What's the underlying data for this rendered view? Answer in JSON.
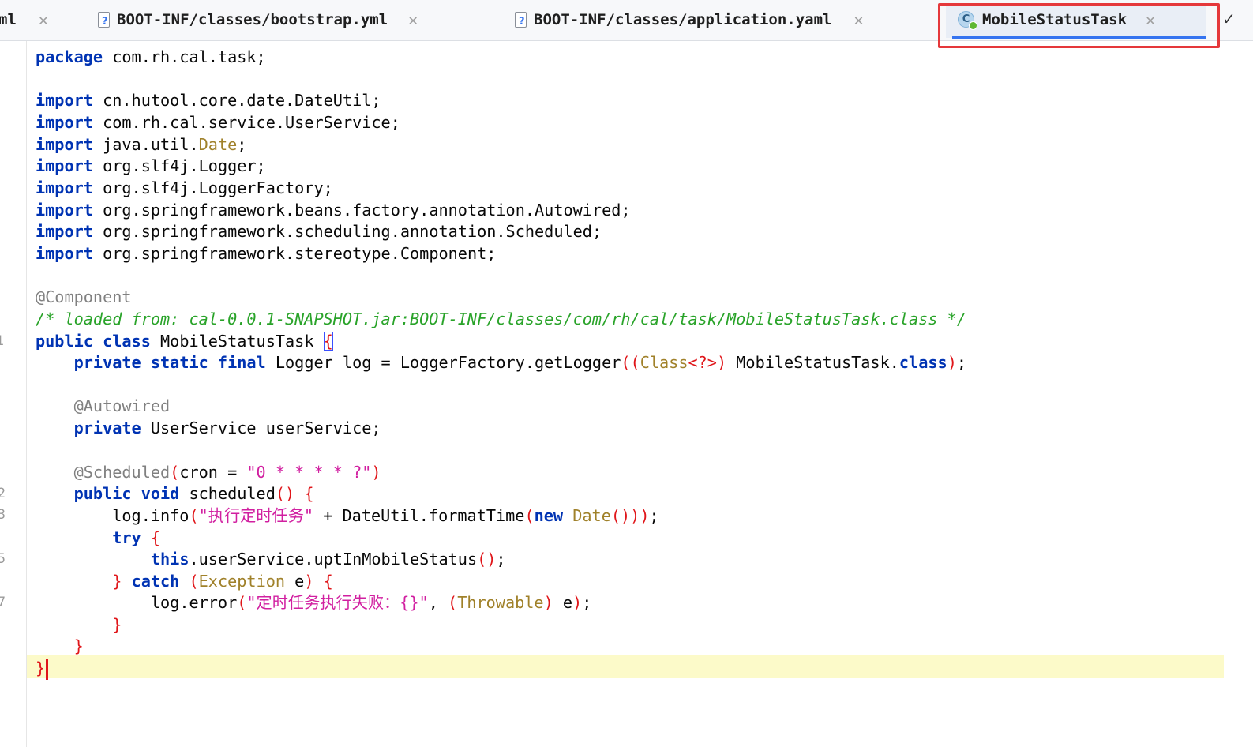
{
  "tabs": [
    {
      "label": "ml",
      "icon": "none",
      "partial": true
    },
    {
      "label": "BOOT-INF/classes/bootstrap.yml",
      "icon": "unknown-file-icon"
    },
    {
      "label": "BOOT-INF/classes/application.yaml",
      "icon": "unknown-file-icon"
    },
    {
      "label": "MobileStatusTask",
      "icon": "java-class-icon",
      "active": true
    }
  ],
  "tab_close_glyph": "✕",
  "class_icon_letter": "C",
  "more_tabs_glyph": "✓",
  "gutter_numbers": [
    "1",
    "2",
    "3",
    "5",
    "7"
  ],
  "code": {
    "package_kw": "package",
    "package_name": " com.rh.cal.task;",
    "imports": [
      {
        "kw": "import",
        "path": " cn.hutool.core.date.DateUtil;"
      },
      {
        "kw": "import",
        "path": " com.rh.cal.service.UserService;"
      },
      {
        "kw": "import",
        "path": " java.util.",
        "type": "Date",
        "tail": ";"
      },
      {
        "kw": "import",
        "path": " org.slf4j.Logger;"
      },
      {
        "kw": "import",
        "path": " org.slf4j.LoggerFactory;"
      },
      {
        "kw": "import",
        "path": " org.springframework.beans.factory.annotation.Autowired;"
      },
      {
        "kw": "import",
        "path": " org.springframework.scheduling.annotation.Scheduled;"
      },
      {
        "kw": "import",
        "path": " org.springframework.stereotype.Component;"
      }
    ],
    "component_annotation": "@Component",
    "loaded_comment": "/* loaded from: cal-0.0.1-SNAPSHOT.jar:BOOT-INF/classes/com/rh/cal/task/MobileStatusTask.class */",
    "class_kw": "public class",
    "class_name": " MobileStatusTask ",
    "open_brace": "{",
    "logger_mods": "private static final",
    "logger_decl": " Logger log = LoggerFactory.getLogger",
    "logger_class_type": "Class",
    "logger_generic": "<?>",
    "logger_target": " MobileStatusTask.",
    "class_literal_kw": "class",
    "autowired_annotation": "@Autowired",
    "field_kw": "private",
    "field_decl": " UserService userService;",
    "scheduled_annotation": "@Scheduled",
    "cron_key": "cron = ",
    "cron_value": "\"0 * * * * ?\"",
    "method_kw": "public void",
    "method_name": " scheduled",
    "info_call": "log.info",
    "info_msg": "\"执行定时任务\"",
    "info_concat": " + DateUtil.formatTime",
    "new_kw": "new",
    "date_type": "Date",
    "try_kw": "try",
    "this_kw": "this",
    "upt_call": ".userService.uptInMobileStatus",
    "catch_kw": "catch",
    "exception_type": "Exception",
    "exception_var": " e",
    "error_call": "log.error",
    "error_msg": "\"定时任务执行失败：{}\"",
    "throwable_type": "Throwable",
    "close_brace": "}"
  }
}
